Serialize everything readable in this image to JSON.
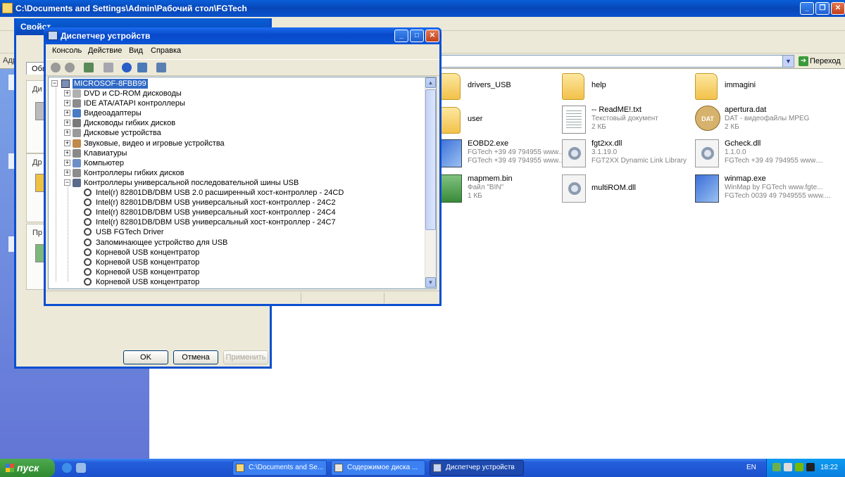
{
  "explorer": {
    "title": "C:\\Documents and Settings\\Admin\\Рабочий стол\\FGTech",
    "address_label": "Адрес",
    "go_label": "Переход",
    "files": [
      {
        "name": "drivers_USB",
        "kind": "folder"
      },
      {
        "name": "help",
        "kind": "folder"
      },
      {
        "name": "immagini",
        "kind": "folder"
      },
      {
        "name": "user",
        "kind": "folder"
      },
      {
        "name": "-- ReadME!.txt",
        "line2": "Текстовый документ",
        "line3": "2 КБ",
        "kind": "doc"
      },
      {
        "name": "apertura.dat",
        "line2": "DAT - видеофайлы MPEG",
        "line3": "2 КБ",
        "kind": "dat"
      },
      {
        "name": "EOBD2.exe",
        "line2": "FGTech  +39 49 794955 www....",
        "line3": "FGTech  +39 49 794955 www....",
        "kind": "exe"
      },
      {
        "name": "fgt2xx.dll",
        "line2": "3.1.19.0",
        "line3": "FGT2XX Dynamic Link Library",
        "kind": "dll"
      },
      {
        "name": "Gcheck.dll",
        "line2": "1.1.0.0",
        "line3": "FGTech  +39 49 794955 www....",
        "kind": "dll"
      },
      {
        "name": "mapmem.bin",
        "line2": "Файл \"BIN\"",
        "line3": "1 КБ",
        "kind": "bin"
      },
      {
        "name": "multiROM.dll",
        "kind": "dll"
      },
      {
        "name": "winmap.exe",
        "line2": "WinMap by FGTech  www.fgte...",
        "line3": "FGTech 0039 49 7949555 www....",
        "kind": "exe"
      }
    ]
  },
  "props": {
    "title": "Свойст",
    "tab": "Общ",
    "section1": "Ди",
    "section2": "Др",
    "section3": "Пр",
    "ok": "OK",
    "cancel": "Отмена",
    "apply": "Применить"
  },
  "devmgr": {
    "title": "Диспетчер устройств",
    "menu": [
      "Консоль",
      "Действие",
      "Вид",
      "Справка"
    ],
    "root": "MICROSOF-8FBB99",
    "categories": [
      "DVD и CD-ROM дисководы",
      "IDE ATA/ATAPI контроллеры",
      "Видеоадаптеры",
      "Дисководы гибких дисков",
      "Дисковые устройства",
      "Звуковые, видео и игровые устройства",
      "Клавиатуры",
      "Компьютер",
      "Контроллеры гибких дисков",
      "Контроллеры универсальной последовательной шины USB"
    ],
    "usb_children": [
      "Intel(r) 82801DB/DBM USB 2.0 расширенный хост-контроллер - 24CD",
      "Intel(r) 82801DB/DBM USB универсальный хост-контроллер - 24C2",
      "Intel(r) 82801DB/DBM USB универсальный хост-контроллер - 24C4",
      "Intel(r) 82801DB/DBM USB универсальный хост-контроллер - 24C7",
      "USB FGTech Driver",
      "Запоминающее устройство для USB",
      "Корневой USB концентратор",
      "Корневой USB концентратор",
      "Корневой USB концентратор",
      "Корневой USB концентратор"
    ]
  },
  "taskbar": {
    "start": "пуск",
    "tasks": [
      "C:\\Documents and Se...",
      "Содержимое диска ...",
      "Диспетчер устройств"
    ],
    "lang": "EN",
    "clock": "18:22"
  },
  "colors": {
    "xp_blue": "#0a55d8",
    "start_green": "#3a9a3a",
    "window_bg": "#ece9d8"
  }
}
